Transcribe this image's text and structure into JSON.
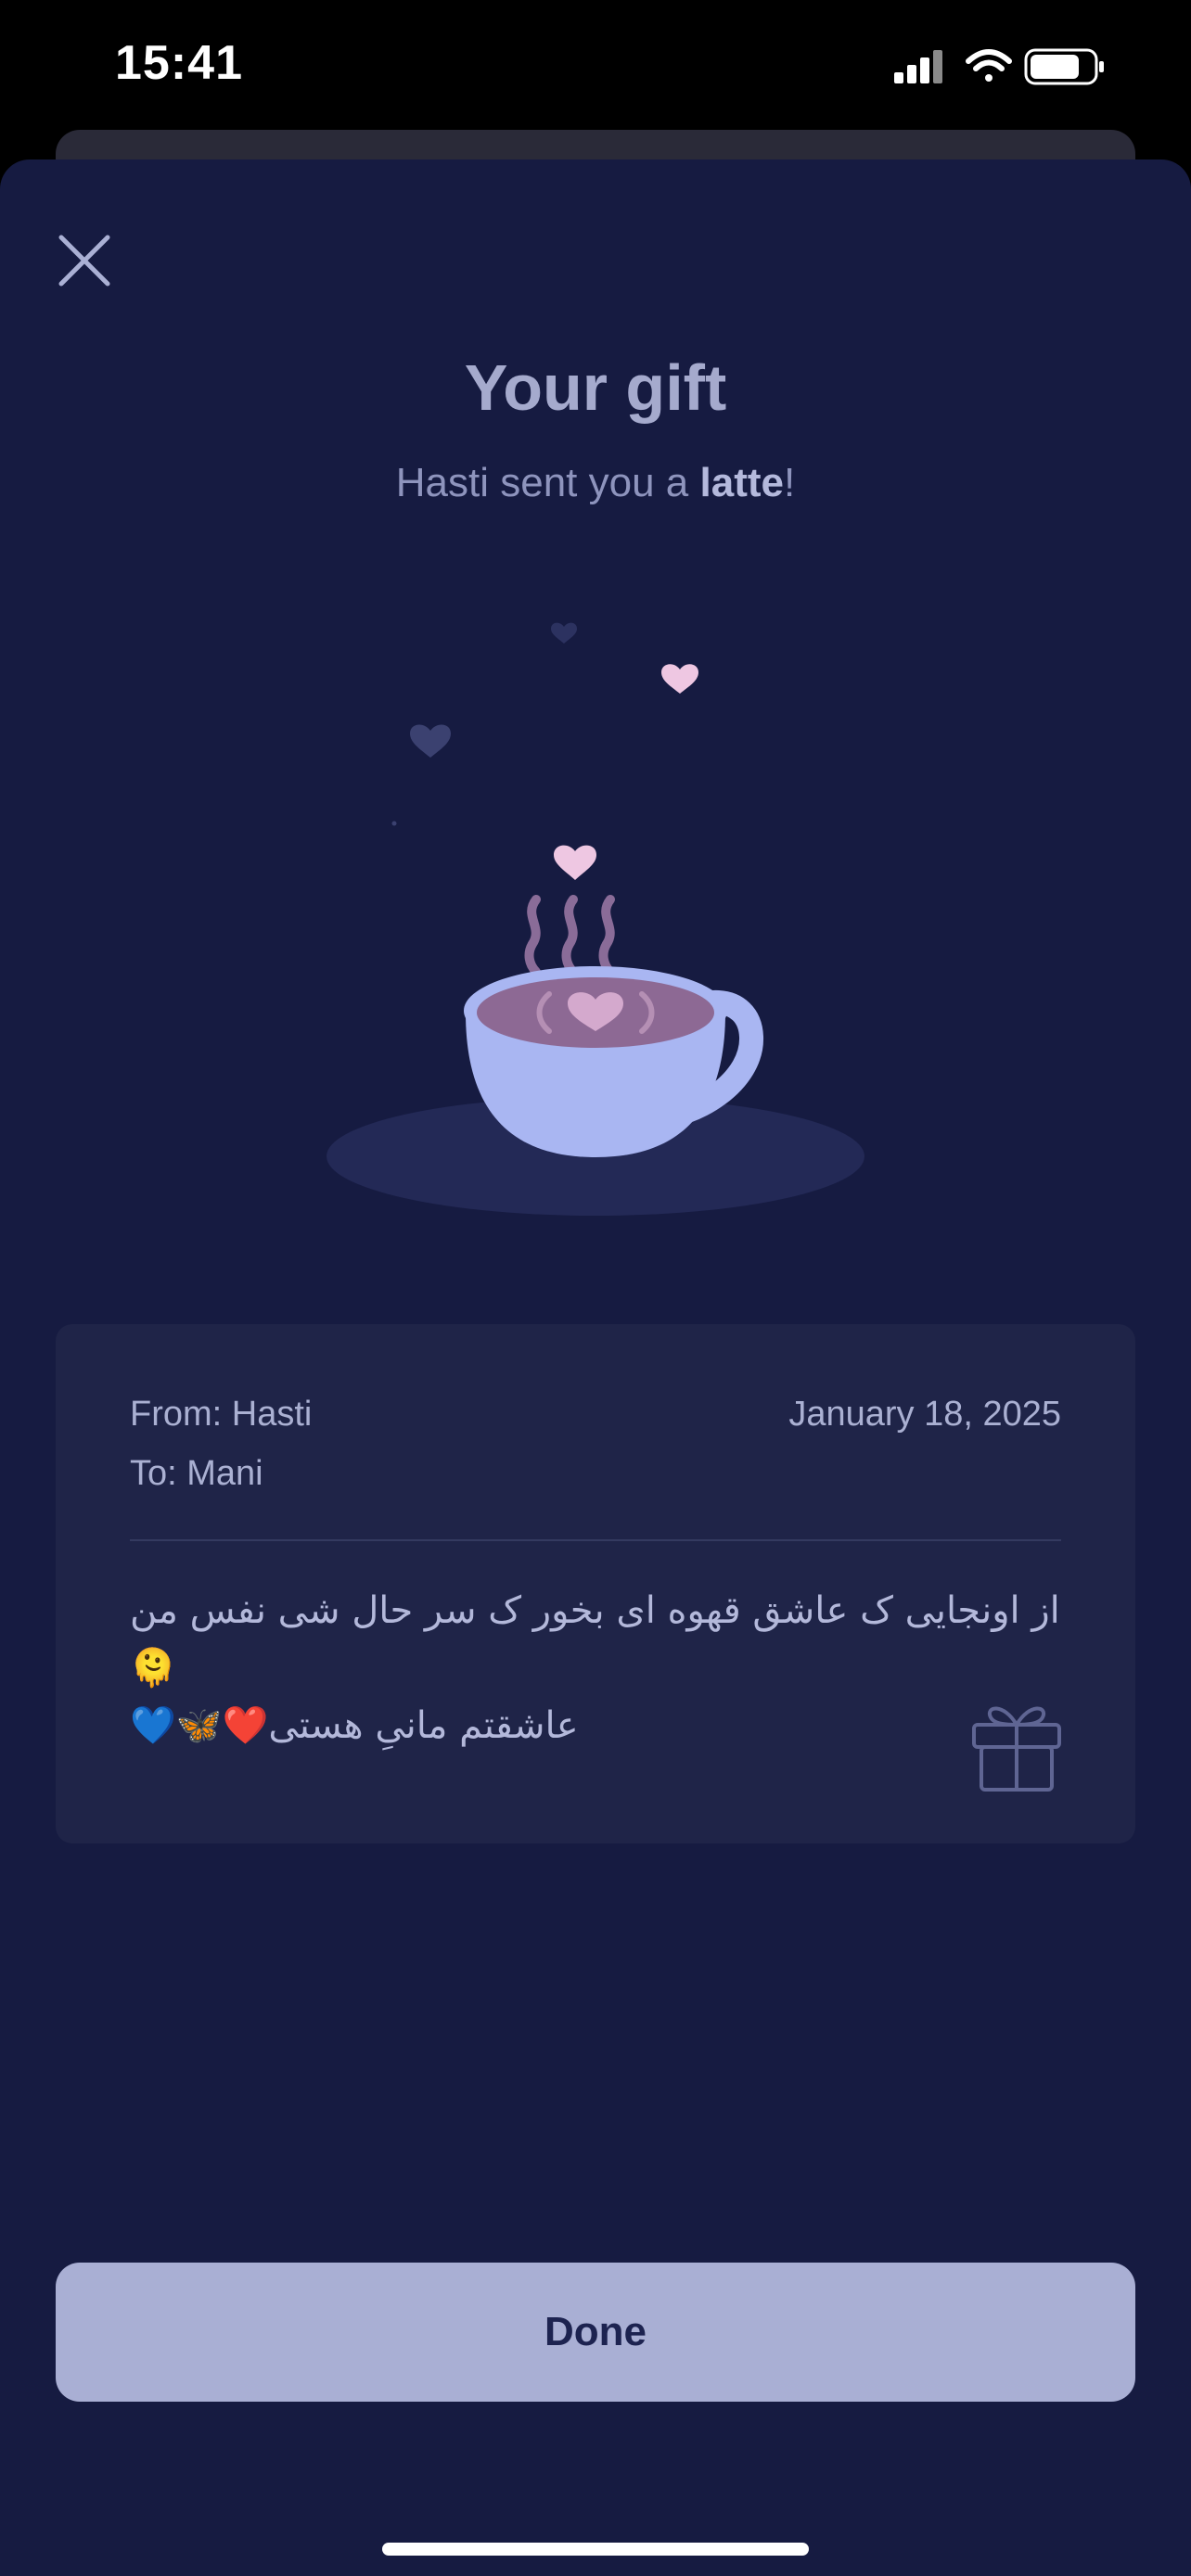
{
  "status_bar": {
    "time": "15:41",
    "icons": [
      "cellular-signal-icon",
      "wifi-icon",
      "battery-icon"
    ]
  },
  "header": {
    "close_icon": "close-icon",
    "title": "Your gift",
    "subtitle_prefix": "Hasti sent you a ",
    "subtitle_item": "latte",
    "subtitle_suffix": "!"
  },
  "illustration": {
    "icon": "coffee-cup-with-hearts-icon"
  },
  "gift_card": {
    "from": "From: Hasti",
    "to": "To: Mani",
    "date": "January 18, 2025",
    "message_line_1": "از اونجایی ک عاشق قهوه ای بخور ک سر حال شی نفس من🫠",
    "message_line_2": "عاشقتم مانیِ هستی❤️🦋💙",
    "gift_icon": "gift-icon"
  },
  "footer": {
    "done_label": "Done"
  },
  "colors": {
    "background": "#161b41",
    "card": "#1f2448",
    "button": "#a9afd4",
    "button_text": "#1d2350",
    "cup": "#a9b6f2",
    "heart_pink": "#eec7e2"
  }
}
